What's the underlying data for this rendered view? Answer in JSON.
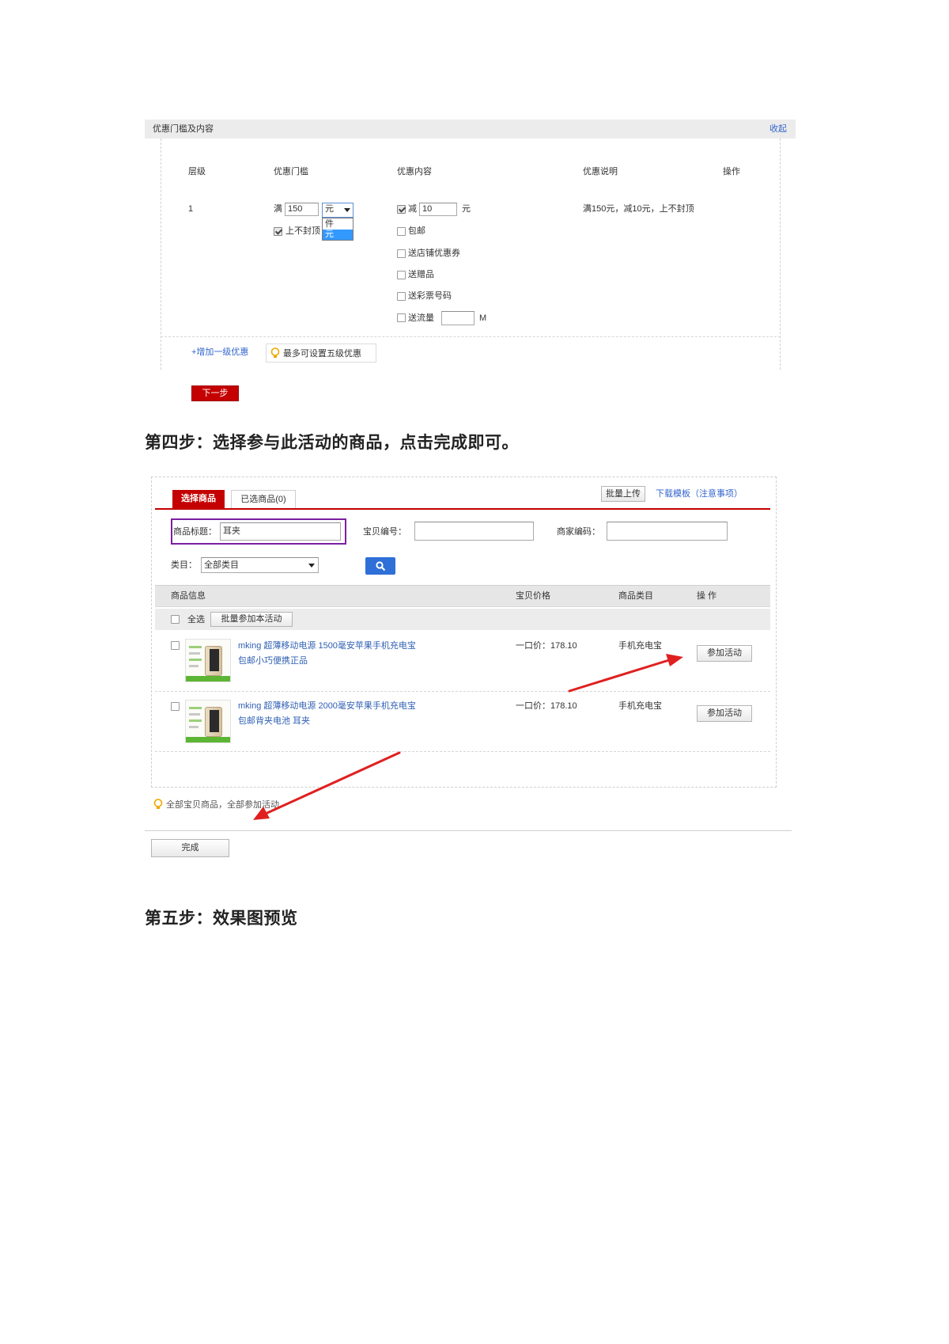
{
  "colors": {
    "accent_red": "#c40000",
    "link_blue": "#3366cc",
    "highlight_purple": "#7b1fa2",
    "arrow_red": "#e02020",
    "search_button_blue": "#2e6fd8"
  },
  "icons": {
    "tip": "lightbulb-icon",
    "search": "search-icon",
    "dropdown": "chevron-down-icon"
  },
  "step3_panel": {
    "header": {
      "title": "优惠门槛及内容",
      "toggle": "收起"
    },
    "columns": {
      "level": "层级",
      "threshold": "优惠门槛",
      "content": "优惠内容",
      "description": "优惠说明",
      "action": "操作"
    },
    "tier": {
      "level": "1",
      "threshold_prefix": "满",
      "threshold_value": "150",
      "unit_selected": "元",
      "unit_options": [
        "件",
        "元"
      ],
      "no_cap": {
        "label": "上不封顶",
        "checked": true
      },
      "discount": {
        "checked": true,
        "prefix": "减",
        "value": "10",
        "unit": "元"
      },
      "extras": [
        {
          "label": "包邮",
          "checked": false
        },
        {
          "label": "送店铺优惠券",
          "checked": false
        },
        {
          "label": "送赠品",
          "checked": false
        },
        {
          "label": "送彩票号码",
          "checked": false
        }
      ],
      "traffic": {
        "label": "送流量",
        "checked": false,
        "value": "",
        "unit": "M"
      },
      "description": "满150元，减10元，上不封顶"
    },
    "add_tier_link": "+增加一级优惠",
    "tip": "最多可设置五级优惠",
    "next_button": "下一步"
  },
  "step4_heading": "第四步：选择参与此活动的商品，点击完成即可。",
  "product_panel": {
    "tabs": [
      {
        "label": "选择商品",
        "active": true
      },
      {
        "label": "已选商品(0)",
        "active": false
      }
    ],
    "batch_upload": "批量上传",
    "template_link": "下载模板（注意事项）",
    "filters": {
      "title_label": "商品标题：",
      "title_value": "耳夹",
      "item_id_label": "宝贝编号：",
      "item_id_value": "",
      "merchant_code_label": "商家编码：",
      "merchant_code_value": "",
      "category_label": "类目：",
      "category_value": "全部类目"
    },
    "table_columns": [
      "商品信息",
      "宝贝价格",
      "商品类目",
      "操 作"
    ],
    "select_all": {
      "label": "全选",
      "checked": false
    },
    "batch_join": "批量参加本活动",
    "products": [
      {
        "title_line1": "mking 超薄移动电源 1500毫安苹果手机充电宝",
        "title_line2": "包邮小巧便携正品",
        "price": "一口价：178.10",
        "category": "手机充电宝",
        "action": "参加活动",
        "checked": false
      },
      {
        "title_line1": "mking 超薄移动电源 2000毫安苹果手机充电宝",
        "title_line2": "包邮背夹电池 耳夹",
        "price": "一口价：178.10",
        "category": "手机充电宝",
        "action": "参加活动",
        "checked": false
      }
    ],
    "tip": "全部宝贝商品，全部参加活动",
    "finish_button": "完成"
  },
  "step5_heading": "第五步：效果图预览"
}
